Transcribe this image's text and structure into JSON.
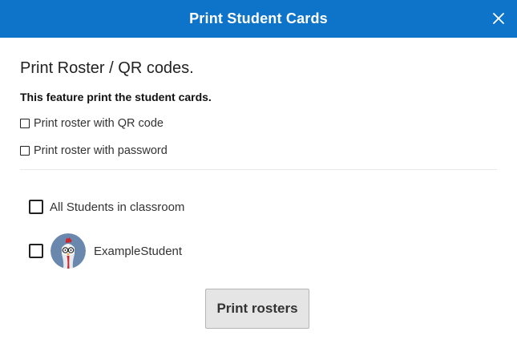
{
  "header": {
    "title": "Print Student Cards",
    "close_icon": "close-icon",
    "background": "#0e74c9"
  },
  "content": {
    "section_title": "Print Roster / QR codes.",
    "description": "This feature print the student cards.",
    "options": [
      {
        "label": "Print roster with QR code",
        "checked": false
      },
      {
        "label": "Print roster with password",
        "checked": false
      }
    ],
    "select_all": {
      "label": "All Students in classroom",
      "checked": false
    },
    "students": [
      {
        "name": "ExampleStudent",
        "avatar_icon": "chicken-avatar-icon",
        "checked": false
      }
    ]
  },
  "footer": {
    "print_label": "Print rosters"
  }
}
